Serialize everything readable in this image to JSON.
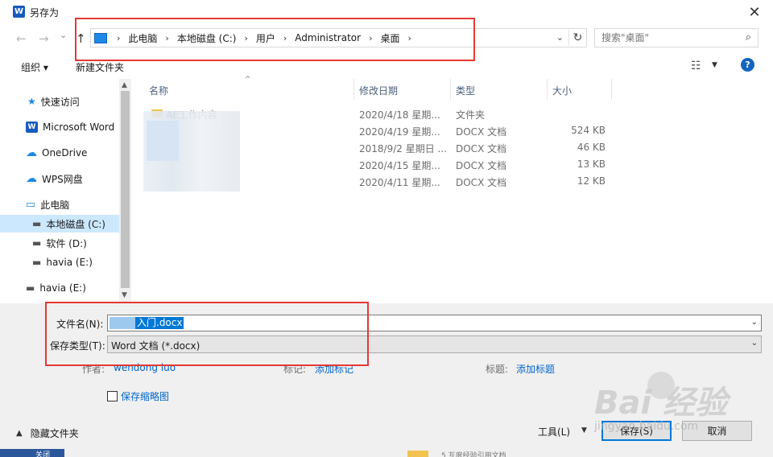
{
  "window": {
    "app_icon_letter": "W",
    "title": "另存为",
    "close_glyph": "✕"
  },
  "nav": {
    "back": "←",
    "forward": "→",
    "recent": "⌄",
    "up": "↑"
  },
  "address": {
    "crumbs": [
      "此电脑",
      "本地磁盘 (C:)",
      "用户",
      "Administrator",
      "桌面"
    ],
    "separator": "›",
    "dropdown": "⌄",
    "refresh": "↻"
  },
  "search": {
    "placeholder": "搜索\"桌面\"",
    "icon": "⌕"
  },
  "toolbar": {
    "organize": "组织 ▾",
    "new_folder": "新建文件夹",
    "view_icon": "☷",
    "view_dd": "▼",
    "help": "?"
  },
  "sidebar": {
    "items": [
      {
        "label": "快速访问",
        "icon": "★",
        "icon_color": "#1e88e5"
      },
      {
        "label": "Microsoft Word",
        "icon": "W",
        "icon_color": "#185abd"
      },
      {
        "label": "OneDrive",
        "icon": "☁",
        "icon_color": "#1e88e5"
      },
      {
        "label": "WPS网盘",
        "icon": "☁",
        "icon_color": "#1e88e5"
      },
      {
        "label": "此电脑",
        "icon": "▭",
        "icon_color": "#1e88e5"
      },
      {
        "label": "本地磁盘 (C:)",
        "icon": "▬",
        "icon_color": "#555555"
      },
      {
        "label": "软件 (D:)",
        "icon": "▬",
        "icon_color": "#555555"
      },
      {
        "label": "havia (E:)",
        "icon": "▬",
        "icon_color": "#555555"
      },
      {
        "label": "havia (E:)",
        "icon": "▬",
        "icon_color": "#555555"
      }
    ],
    "scroll_up": "▲",
    "scroll_down": "▼"
  },
  "columns": {
    "name": "名称",
    "modified": "修改日期",
    "type": "类型",
    "size": "大小",
    "sort_arrow": "^"
  },
  "files": [
    {
      "name": "AE工作内容",
      "modified": "2020/4/18 星期...",
      "type": "文件夹",
      "size": ""
    },
    {
      "name": "",
      "modified": "2020/4/19 星期...",
      "type": "DOCX 文档",
      "size": "524 KB"
    },
    {
      "name": "",
      "modified": "2018/9/2 星期日 ...",
      "type": "DOCX 文档",
      "size": "46 KB"
    },
    {
      "name": "",
      "modified": "2020/4/15 星期...",
      "type": "DOCX 文档",
      "size": "13 KB"
    },
    {
      "name": "",
      "modified": "2020/4/11 星期...",
      "type": "DOCX 文档",
      "size": "12 KB"
    }
  ],
  "form": {
    "filename_label": "文件名(N):",
    "filename_value": "入门.docx",
    "filetype_label": "保存类型(T):",
    "filetype_value": "Word 文档 (*.docx)",
    "dd": "⌄",
    "author_label": "作者:",
    "author_value": "wendong luo",
    "tags_label": "标记:",
    "tags_value": "添加标记",
    "title_label": "标题:",
    "title_value": "添加标题",
    "thumbnail_label": "保存缩略图"
  },
  "footer": {
    "hide_folders": "隐藏文件夹",
    "caret": "▲",
    "tools": "工具(L)",
    "tools_dd": "▼",
    "save": "保存(S)",
    "cancel": "取消"
  },
  "watermark": {
    "main": "Bai  经验",
    "sub": "jingyan.baidu.com"
  },
  "background": {
    "close_text": "关闭",
    "bottom_text": "5    互度经验引用文档"
  },
  "colors": {
    "accent": "#0078d7",
    "annotation": "#e53935",
    "link": "#0066cc",
    "selection_bg": "#cce8ff"
  }
}
